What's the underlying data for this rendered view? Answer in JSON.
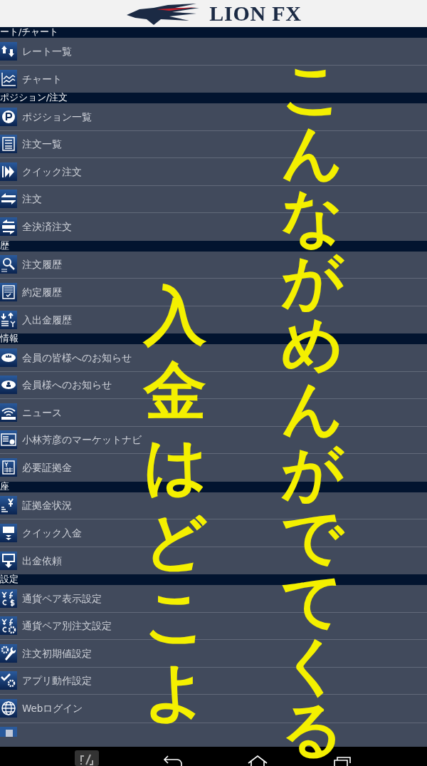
{
  "header": {
    "logo_text": "LION FX"
  },
  "sections": [
    {
      "title": "ート/チャート",
      "items": [
        {
          "label": "レート一覧"
        },
        {
          "label": "チャート"
        }
      ]
    },
    {
      "title": "ポジション/注文",
      "items": [
        {
          "label": "ポジション一覧"
        },
        {
          "label": "注文一覧"
        },
        {
          "label": "クイック注文"
        },
        {
          "label": "注文"
        },
        {
          "label": "全決済注文"
        }
      ]
    },
    {
      "title": "歴",
      "items": [
        {
          "label": "注文履歴"
        },
        {
          "label": "約定履歴"
        },
        {
          "label": "入出金履歴"
        }
      ]
    },
    {
      "title": "情報",
      "items": [
        {
          "label": "会員の皆様へのお知らせ"
        },
        {
          "label": "会員様へのお知らせ"
        },
        {
          "label": "ニュース"
        },
        {
          "label": "小林芳彦のマーケットナビ"
        },
        {
          "label": "必要証拠金"
        }
      ]
    },
    {
      "title": "座",
      "items": [
        {
          "label": "証拠金状況"
        },
        {
          "label": "クイック入金"
        },
        {
          "label": "出金依頼"
        }
      ]
    },
    {
      "title": "設定",
      "items": [
        {
          "label": "通貨ペア表示設定"
        },
        {
          "label": "通貨ペア別注文設定"
        },
        {
          "label": "注文初期値設定"
        },
        {
          "label": "アプリ動作設定"
        },
        {
          "label": "Webログイン"
        }
      ]
    }
  ],
  "handwriting": [
    {
      "text": "こんながめんがでてくる"
    },
    {
      "text": "入金はどこよ"
    }
  ]
}
